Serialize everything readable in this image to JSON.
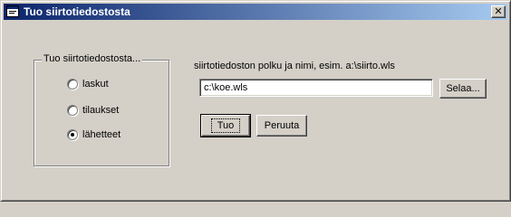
{
  "window": {
    "title": "Tuo siirtotiedostosta",
    "close_glyph": "✕"
  },
  "group": {
    "legend": "Tuo siirtotiedostosta...",
    "options": [
      {
        "label": "laskut",
        "checked": false
      },
      {
        "label": "tilaukset",
        "checked": false
      },
      {
        "label": "lähetteet",
        "checked": true
      }
    ]
  },
  "file": {
    "label": "siirtotiedoston polku ja nimi, esim. a:\\siirto.wls",
    "value": "c:\\koe.wls",
    "browse_label": "Selaa..."
  },
  "actions": {
    "ok_label": "Tuo",
    "cancel_label": "Peruuta"
  },
  "icons": {
    "title_icon": "app-window-icon"
  },
  "colors": {
    "titlebar_start": "#0a246a",
    "titlebar_end": "#a6caf0",
    "face": "#d4d0c8"
  }
}
